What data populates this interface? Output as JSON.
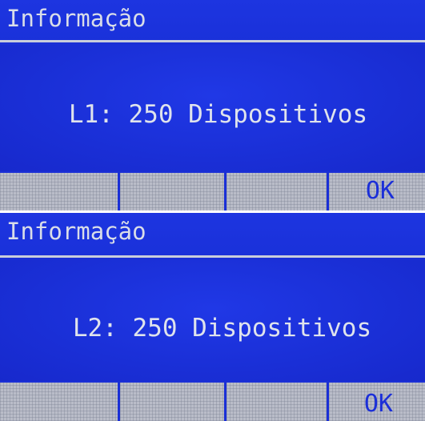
{
  "screens": [
    {
      "title": "Informação",
      "message": "L1: 250 Dispositivos",
      "softkeys": [
        "",
        "",
        "",
        "OK"
      ]
    },
    {
      "title": "Informação",
      "message": "L2: 250 Dispositivos",
      "softkeys": [
        "",
        "",
        "",
        "OK"
      ]
    }
  ],
  "colors": {
    "lcd_background": "#1a2fd6",
    "lcd_text": "#dfe3ec",
    "softkey_background": "#b9bcc8",
    "softkey_text": "#1b2fd8"
  }
}
